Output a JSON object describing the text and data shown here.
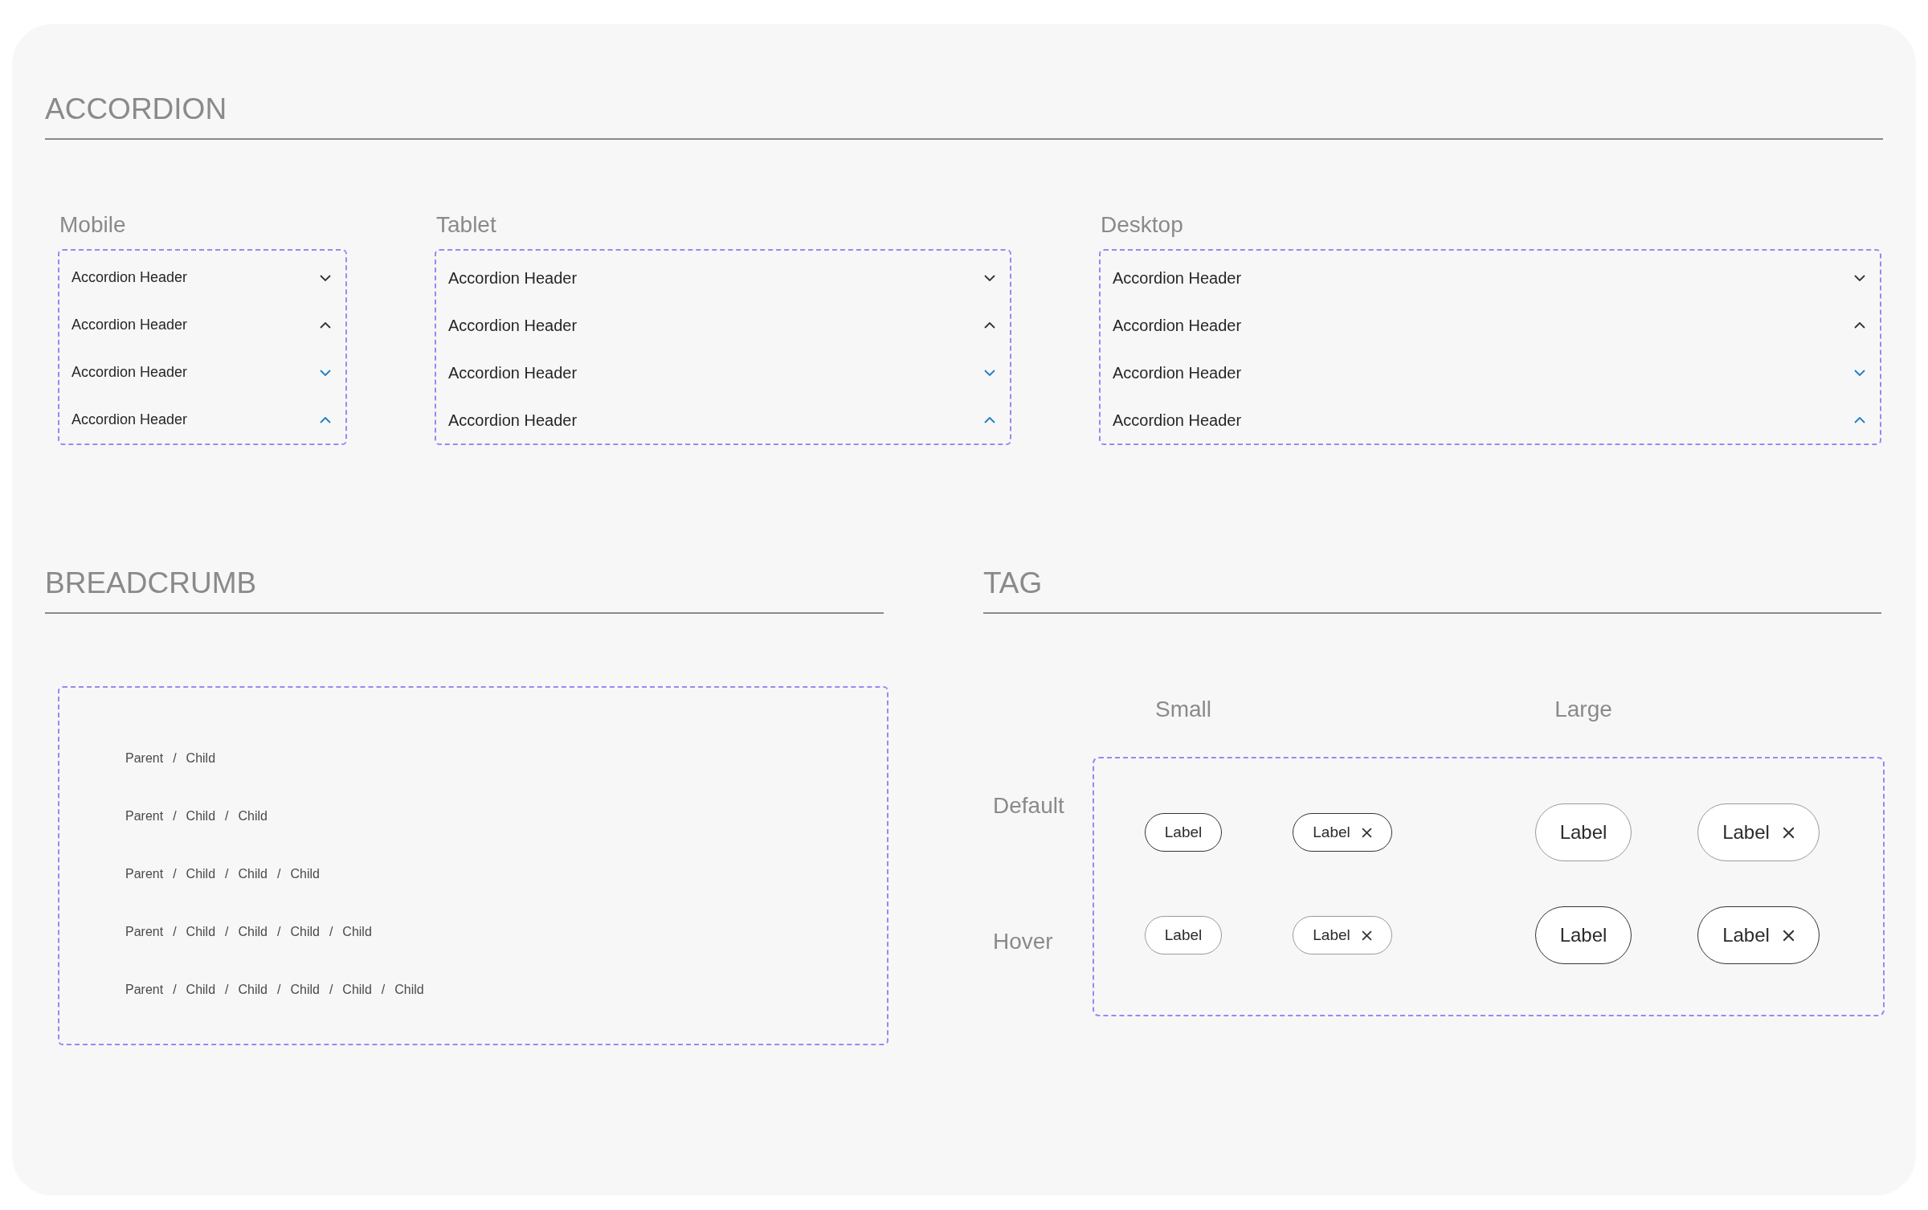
{
  "accordion": {
    "title": "ACCORDION",
    "variants": [
      {
        "label": "Mobile",
        "kind": "mobile",
        "items": [
          {
            "header": "Accordion Header",
            "expanded": false,
            "color": "#333333"
          },
          {
            "header": "Accordion Header",
            "expanded": true,
            "color": "#333333"
          },
          {
            "header": "Accordion Header",
            "expanded": false,
            "color": "#1a7fc4"
          },
          {
            "header": "Accordion Header",
            "expanded": true,
            "color": "#1a7fc4"
          }
        ]
      },
      {
        "label": "Tablet",
        "kind": "tablet",
        "items": [
          {
            "header": "Accordion Header",
            "expanded": false,
            "color": "#333333"
          },
          {
            "header": "Accordion Header",
            "expanded": true,
            "color": "#333333"
          },
          {
            "header": "Accordion Header",
            "expanded": false,
            "color": "#1a7fc4"
          },
          {
            "header": "Accordion Header",
            "expanded": true,
            "color": "#1a7fc4"
          }
        ]
      },
      {
        "label": "Desktop",
        "kind": "desktop",
        "items": [
          {
            "header": "Accordion Header",
            "expanded": false,
            "color": "#333333"
          },
          {
            "header": "Accordion Header",
            "expanded": true,
            "color": "#333333"
          },
          {
            "header": "Accordion Header",
            "expanded": false,
            "color": "#1a7fc4"
          },
          {
            "header": "Accordion Header",
            "expanded": true,
            "color": "#1a7fc4"
          }
        ]
      }
    ]
  },
  "breadcrumb": {
    "title": "BREADCRUMB",
    "rows": [
      {
        "items": [
          {
            "label": "Parent"
          },
          {
            "separator": "/",
            "label": "Child"
          }
        ]
      },
      {
        "items": [
          {
            "label": "Parent"
          },
          {
            "separator": "/",
            "label": "Child"
          },
          {
            "separator": "/",
            "label": "Child"
          }
        ]
      },
      {
        "items": [
          {
            "label": "Parent"
          },
          {
            "separator": "/",
            "label": "Child"
          },
          {
            "separator": "/",
            "label": "Child"
          },
          {
            "separator": "/",
            "label": "Child"
          }
        ]
      },
      {
        "items": [
          {
            "label": "Parent"
          },
          {
            "separator": "/",
            "label": "Child"
          },
          {
            "separator": "/",
            "label": "Child"
          },
          {
            "separator": "/",
            "label": "Child"
          },
          {
            "separator": "/",
            "label": "Child"
          }
        ]
      },
      {
        "items": [
          {
            "label": "Parent"
          },
          {
            "separator": "/",
            "label": "Child"
          },
          {
            "separator": "/",
            "label": "Child"
          },
          {
            "separator": "/",
            "label": "Child"
          },
          {
            "separator": "/",
            "label": "Child"
          },
          {
            "separator": "/",
            "label": "Child"
          }
        ]
      }
    ]
  },
  "tag": {
    "title": "TAG",
    "columns": [
      {
        "label": "Small"
      },
      {
        "label": "Large"
      }
    ],
    "rows": [
      {
        "label": "Default",
        "kind": "default",
        "tags": [
          {
            "kind": "small",
            "label": "Label",
            "removable": false
          },
          {
            "kind": "small",
            "label": "Label",
            "removable": true
          },
          {
            "kind": "large",
            "label": "Label",
            "removable": false
          },
          {
            "kind": "large",
            "label": "Label",
            "removable": true
          }
        ]
      },
      {
        "label": "Hover",
        "kind": "hover",
        "tags": [
          {
            "kind": "small",
            "label": "Label",
            "removable": false
          },
          {
            "kind": "small",
            "label": "Label",
            "removable": true
          },
          {
            "kind": "large",
            "label": "Label",
            "removable": false
          },
          {
            "kind": "large",
            "label": "Label",
            "removable": true
          }
        ]
      }
    ]
  }
}
